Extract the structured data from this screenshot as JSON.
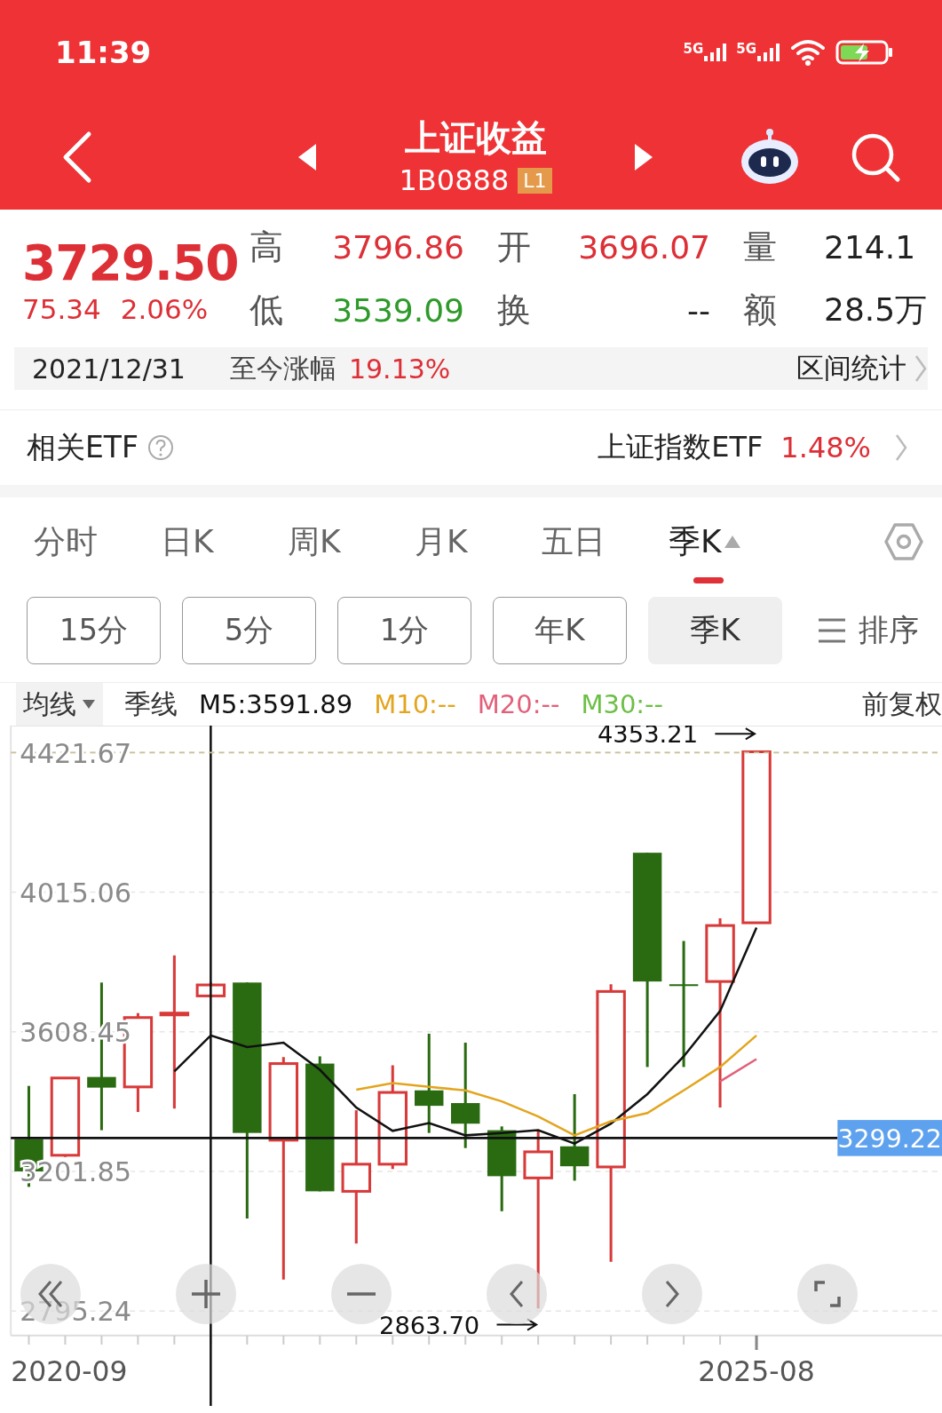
{
  "status_bar": {
    "time": "11:39",
    "networks": [
      "5G",
      "5G"
    ]
  },
  "nav": {
    "title": "上证收益",
    "code": "1B0888",
    "badge": "L1"
  },
  "quote": {
    "price": "3729.50",
    "change": "75.34",
    "change_pct": "2.06%",
    "stats": [
      {
        "label": "高",
        "value": "3796.86",
        "color": "#dd2f36"
      },
      {
        "label": "开",
        "value": "3696.07",
        "color": "#dd2f36"
      },
      {
        "label": "量",
        "value": "214.1",
        "color": "#222222"
      },
      {
        "label": "低",
        "value": "3539.09",
        "color": "#2e9a2a"
      },
      {
        "label": "换",
        "value": "--",
        "color": "#222222"
      },
      {
        "label": "额",
        "value": "28.5万",
        "color": "#222222"
      }
    ]
  },
  "range": {
    "date": "2021/12/31",
    "label": "至今涨幅",
    "value": "19.13%",
    "link": "区间统计"
  },
  "etf": {
    "label": "相关ETF",
    "name": "上证指数ETF",
    "value": "1.48%"
  },
  "period_tabs": [
    {
      "label": "分时",
      "selected": false
    },
    {
      "label": "日K",
      "selected": false
    },
    {
      "label": "周K",
      "selected": false
    },
    {
      "label": "月K",
      "selected": false
    },
    {
      "label": "五日",
      "selected": false
    },
    {
      "label": "季K",
      "selected": true
    }
  ],
  "sub_tabs": [
    {
      "label": "15分",
      "selected": false
    },
    {
      "label": "5分",
      "selected": false
    },
    {
      "label": "1分",
      "selected": false
    },
    {
      "label": "年K",
      "selected": false
    },
    {
      "label": "季K",
      "selected": true
    }
  ],
  "sort": {
    "label": "排序"
  },
  "legend": {
    "ma_menu": "均线",
    "period": "季线",
    "items": [
      {
        "text": "M5:3591.89",
        "color": "#111111"
      },
      {
        "text": "M10:--",
        "color": "#e3a51f"
      },
      {
        "text": "M20:--",
        "color": "#e2607a"
      },
      {
        "text": "M30:--",
        "color": "#6cbf45"
      }
    ],
    "adjust": "前复权"
  },
  "chart": {
    "x_labels": [
      "2020-09",
      "2025-08"
    ],
    "chart_data": {
      "type": "line",
      "ylim": [
        2724,
        4500
      ],
      "grid": true,
      "yticks": [
        {
          "value": 4421.67,
          "label": "4421.67"
        },
        {
          "value": 4015.06,
          "label": "4015.06"
        },
        {
          "value": 3608.45,
          "label": "3608.45"
        },
        {
          "value": 3201.85,
          "label": "3201.85"
        },
        {
          "value": 2795.24,
          "label": "2795.24"
        }
      ],
      "series": [
        {
          "color": "#111111",
          "values": [
            null,
            null,
            null,
            null,
            3493,
            3598,
            3564,
            3577,
            3498,
            3388,
            3320,
            3343,
            3307,
            3314,
            3322,
            3283,
            3341,
            3427,
            3537,
            3669,
            3912
          ]
        },
        {
          "color": "#e3a51f",
          "values": [
            null,
            null,
            null,
            null,
            null,
            null,
            null,
            null,
            null,
            3440,
            3459,
            3448,
            3438,
            3406,
            3362,
            3307,
            3348,
            3372,
            3438,
            3506,
            3598
          ]
        },
        {
          "color": "#e2607a",
          "values": [
            null,
            null,
            null,
            null,
            null,
            null,
            null,
            null,
            null,
            null,
            null,
            null,
            null,
            null,
            null,
            null,
            null,
            null,
            null,
            3464,
            3529
          ]
        }
      ],
      "ref_lines": [
        {
          "axis": "y",
          "value": 4421.67,
          "color": "#c9c29a"
        },
        {
          "axis": "y",
          "value": 3299.22,
          "color": "#111111",
          "label": "3299.22"
        }
      ],
      "annotations": [
        {
          "text": "4353.21"
        },
        {
          "text": "2863.70"
        }
      ]
    }
  }
}
